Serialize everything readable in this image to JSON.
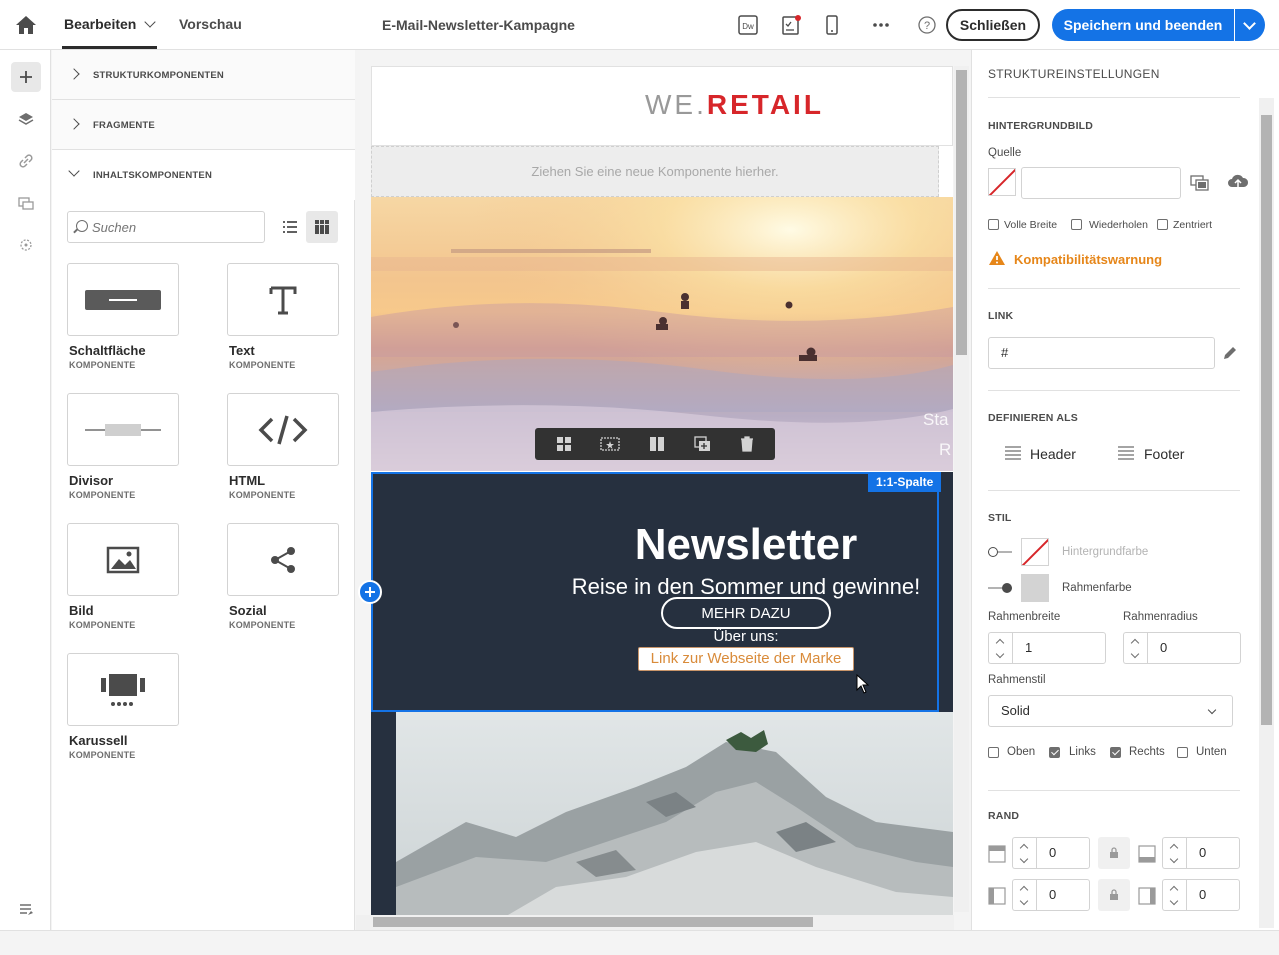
{
  "topbar": {
    "tab_edit": "Bearbeiten",
    "tab_preview": "Vorschau",
    "campaign_title": "E-Mail-Newsletter-Kampagne",
    "close_label": "Schließen",
    "save_label": "Speichern und beenden",
    "dw_label": "Dw"
  },
  "components_panel": {
    "sections": [
      {
        "label": "STRUKTURKOMPONENTEN",
        "expanded": false
      },
      {
        "label": "FRAGMENTE",
        "expanded": false
      },
      {
        "label": "INHALTSKOMPONENTEN",
        "expanded": true
      }
    ],
    "search_placeholder": "Suchen",
    "items": [
      {
        "name": "Schaltfläche",
        "sub": "KOMPONENTE",
        "icon": "button-icon"
      },
      {
        "name": "Text",
        "sub": "KOMPONENTE",
        "icon": "text-icon"
      },
      {
        "name": "Divisor",
        "sub": "KOMPONENTE",
        "icon": "divider-icon"
      },
      {
        "name": "HTML",
        "sub": "KOMPONENTE",
        "icon": "html-icon"
      },
      {
        "name": "Bild",
        "sub": "KOMPONENTE",
        "icon": "image-icon"
      },
      {
        "name": "Sozial",
        "sub": "KOMPONENTE",
        "icon": "share-icon"
      },
      {
        "name": "Karussell",
        "sub": "KOMPONENTE",
        "icon": "carousel-icon"
      }
    ]
  },
  "email": {
    "logo_we": "WE.",
    "logo_retail": "RETAIL",
    "dropzone_text": "Ziehen Sie eine neue Komponente hierher.",
    "column_badge": "1:1-Spalte",
    "title": "Newsletter",
    "subtitle": "Reise in den Sommer und gewinne!",
    "more_button": "MEHR DAZU",
    "about_text": "Über uns:",
    "brand_link": "Link zur Webseite der Marke",
    "hero_overlay_text_1": "Sta",
    "hero_overlay_text_2": "R"
  },
  "settings": {
    "title": "STRUKTUREINSTELLUNGEN",
    "background_image": {
      "heading": "HINTERGRUNDBILD",
      "source_label": "Quelle",
      "source_value": "",
      "full_width": "Volle Breite",
      "repeat": "Wiederholen",
      "centered": "Zentriert",
      "warning": "Kompatibilitätswarnung"
    },
    "link": {
      "heading": "LINK",
      "value": "#"
    },
    "define_as": {
      "heading": "DEFINIEREN ALS",
      "header": "Header",
      "footer": "Footer"
    },
    "style": {
      "heading": "STIL",
      "bg_color_label": "Hintergrundfarbe",
      "border_color_label": "Rahmenfarbe",
      "border_width_label": "Rahmenbreite",
      "border_width_value": "1",
      "border_radius_label": "Rahmenradius",
      "border_radius_value": "0",
      "border_style_label": "Rahmenstil",
      "border_style_value": "Solid",
      "sides": [
        {
          "label": "Oben",
          "checked": false
        },
        {
          "label": "Links",
          "checked": true
        },
        {
          "label": "Rechts",
          "checked": true
        },
        {
          "label": "Unten",
          "checked": false
        }
      ]
    },
    "margin": {
      "heading": "RAND",
      "top": "0",
      "bottom": "0",
      "left": "0",
      "right": "0"
    }
  },
  "colors": {
    "accent": "#1473e6",
    "newsletter_bg": "#26303f",
    "warning": "#e68619",
    "brand_red": "#d7262a"
  }
}
